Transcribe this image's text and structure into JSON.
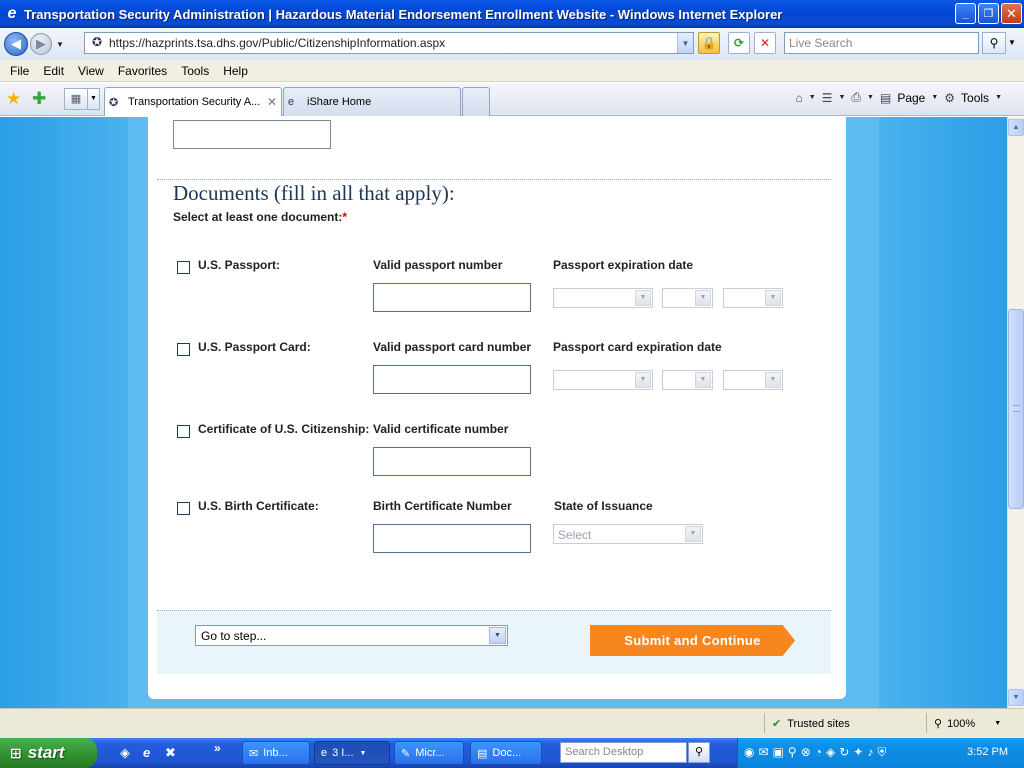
{
  "window": {
    "title": "Transportation Security Administration | Hazardous Material Endorsement Enrollment Website - Windows Internet Explorer",
    "min_glyph": "_",
    "max_glyph": "❐",
    "close_glyph": "✕"
  },
  "address_bar": {
    "url": "https://hazprints.tsa.dhs.gov/Public/CitizenshipInformation.aspx",
    "search_placeholder": "Live Search"
  },
  "menu": [
    "File",
    "Edit",
    "View",
    "Favorites",
    "Tools",
    "Help"
  ],
  "tabs": [
    {
      "label": "Transportation Security A...",
      "active": true
    },
    {
      "label": "iShare Home",
      "active": false
    }
  ],
  "commands": {
    "page_label": "Page",
    "tools_label": "Tools"
  },
  "form": {
    "section_title": "Documents (fill in all that apply):",
    "section_subtitle": "Select at least one document:",
    "required_mark": "*",
    "rows": [
      {
        "checkbox_label": "U.S. Passport:",
        "number_label": "Valid passport number",
        "date_label": "Passport expiration date"
      },
      {
        "checkbox_label": "U.S. Passport Card:",
        "number_label": "Valid passport card number",
        "date_label": "Passport card expiration date"
      },
      {
        "checkbox_label": "Certificate of U.S. Citizenship:",
        "number_label": "Valid certificate number"
      },
      {
        "checkbox_label": "U.S. Birth Certificate:",
        "number_label": "Birth Certificate Number",
        "state_label": "State of Issuance",
        "state_placeholder": "Select"
      }
    ],
    "goto_step_value": "Go to step...",
    "submit_label": "Submit and Continue"
  },
  "status_bar": {
    "zone": "Trusted sites",
    "zoom": "100%"
  },
  "taskbar": {
    "start_label": "start",
    "tasks": [
      {
        "label": "Inb...",
        "active": false
      },
      {
        "label": "3 I...",
        "active": true
      },
      {
        "label": "Micr...",
        "active": false
      },
      {
        "label": "Doc...",
        "active": false
      }
    ],
    "search_placeholder": "Search Desktop",
    "clock": "3:52 PM",
    "overflow_glyph": "»"
  },
  "colors": {
    "titlebar": "#0a58e6",
    "page_bg": "#3ba7e7",
    "submit": "#f7861e",
    "heading": "#1c3755",
    "required": "#cc0000"
  }
}
